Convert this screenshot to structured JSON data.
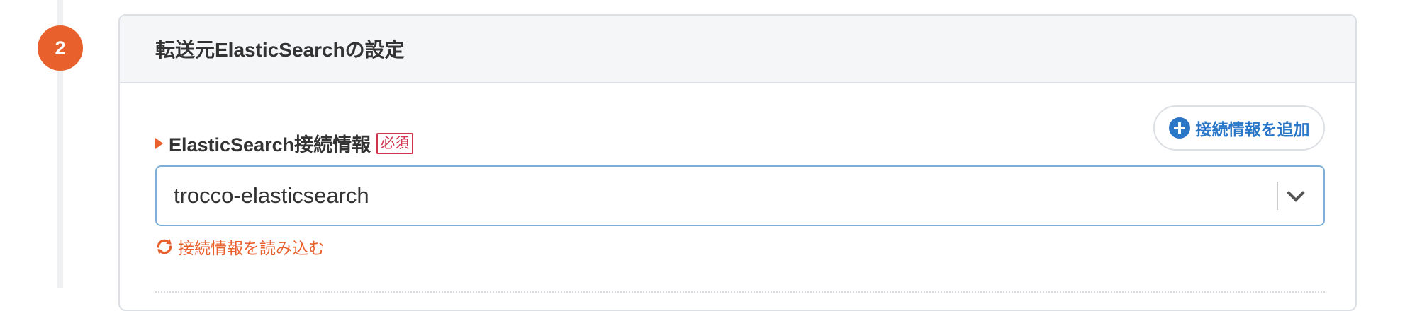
{
  "step": {
    "number": "2"
  },
  "section": {
    "title": "転送元ElasticSearchの設定"
  },
  "connection_field": {
    "label": "ElasticSearch接続情報",
    "required_badge": "必須",
    "add_button_label": "接続情報を追加",
    "selected_value": "trocco-elasticsearch",
    "reload_label": "接続情報を読み込む"
  },
  "icons": {
    "add": "plus-circle-icon",
    "dropdown": "chevron-down-icon",
    "reload": "sync-icon",
    "label_marker": "caret-right-icon"
  },
  "colors": {
    "accent_orange": "#e8602c",
    "link_blue": "#2b77c7",
    "required_red": "#d1344f",
    "select_border": "#7eaed8"
  }
}
